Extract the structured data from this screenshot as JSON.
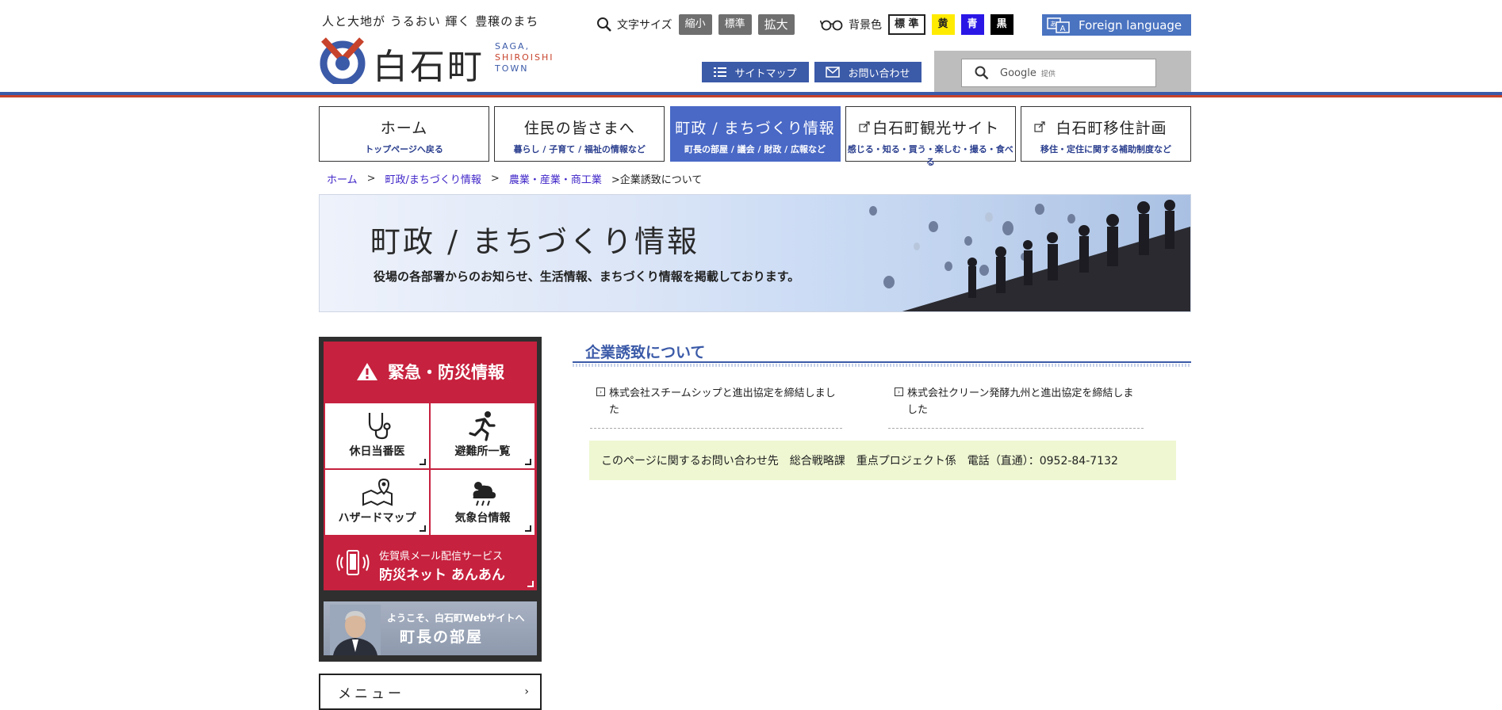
{
  "header": {
    "tagline": "人と大地が うるおい 輝く 豊穣のまち",
    "logo_text": "白石町",
    "logo_en_1": "SAGA,",
    "logo_en_2": "SHIROISHI",
    "logo_en_3": "TOWN",
    "fontsize_label": "文字サイズ",
    "fontsize_small": "縮小",
    "fontsize_standard": "標準",
    "fontsize_large": "拡大",
    "bgcolor_label": "背景色",
    "bgcolor_standard": "標 準",
    "bgcolor_yellow": "黄",
    "bgcolor_blue": "青",
    "bgcolor_black": "黒",
    "foreign_language": "Foreign language",
    "sitemap": "サイトマップ",
    "contact": "お問い合わせ",
    "search_google": "Google",
    "search_provided": "提供"
  },
  "gnav": [
    {
      "main": "ホーム",
      "sub": "トップページへ戻る"
    },
    {
      "main": "住民の皆さまへ",
      "sub": "暮らし / 子育て / 福祉の情報など"
    },
    {
      "main": "町政 / まちづくり情報",
      "sub": "町長の部屋 / 議会 / 財政 / 広報など"
    },
    {
      "main": "白石町観光サイト",
      "sub": "感じる・知る・買う・楽しむ・撮る・食べる"
    },
    {
      "main": "白石町移住計画",
      "sub": "移住・定住に関する補助制度など"
    }
  ],
  "breadcrumb": {
    "home": "ホーム",
    "sep": ">",
    "level1": "町政/まちづくり情報",
    "level2": "農業・産業・商工業",
    "current": ">企業誘致について"
  },
  "banner": {
    "title": "町政 / まちづくり情報",
    "subtitle": "役場の各部署からのお知らせ、生活情報、まちづくり情報を掲載しております。"
  },
  "sidebar": {
    "disaster_title": "緊急・防災情報",
    "cells": [
      "休日当番医",
      "避難所一覧",
      "ハザードマップ",
      "気象台情報"
    ],
    "anshin_line1": "佐賀県メール配信サービス",
    "anshin_line2": "防災ネット あんあん",
    "mayor_line1": "ようこそ、白石町Webサイトへ",
    "mayor_line2": "町長の部屋",
    "menu_label": "メニュー",
    "menu_arrow": "›"
  },
  "main": {
    "title": "企業誘致について",
    "links": [
      "株式会社スチームシップと進出協定を締結しました",
      "株式会社クリーン発酵九州と進出協定を締結しました"
    ],
    "contact": "このページに関するお問い合わせ先　総合戦略課　重点プロジェクト係　電話（直通）：0952-84-7132"
  },
  "colors": {
    "brand_blue": "#3b5aa8",
    "brand_red": "#c7432b",
    "nav_active": "#4a69c6",
    "disaster_red": "#c6213e",
    "contact_bg": "#eef7d2"
  }
}
